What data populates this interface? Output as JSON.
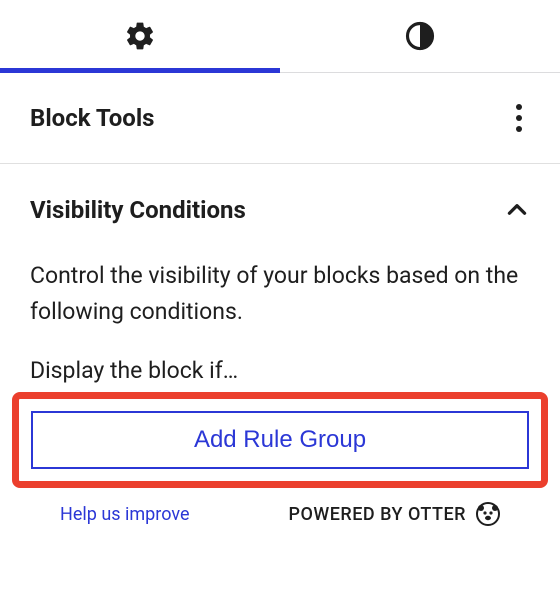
{
  "tabs": {
    "settings_icon": "gear",
    "styles_icon": "contrast"
  },
  "block_tools": {
    "title": "Block Tools"
  },
  "visibility": {
    "title": "Visibility Conditions",
    "description": "Control the visibility of your blocks based on the following conditions.",
    "prompt": "Display the block if…",
    "add_rule_group": "Add Rule Group"
  },
  "footer": {
    "help": "Help us improve",
    "powered": "POWERED BY OTTER"
  }
}
